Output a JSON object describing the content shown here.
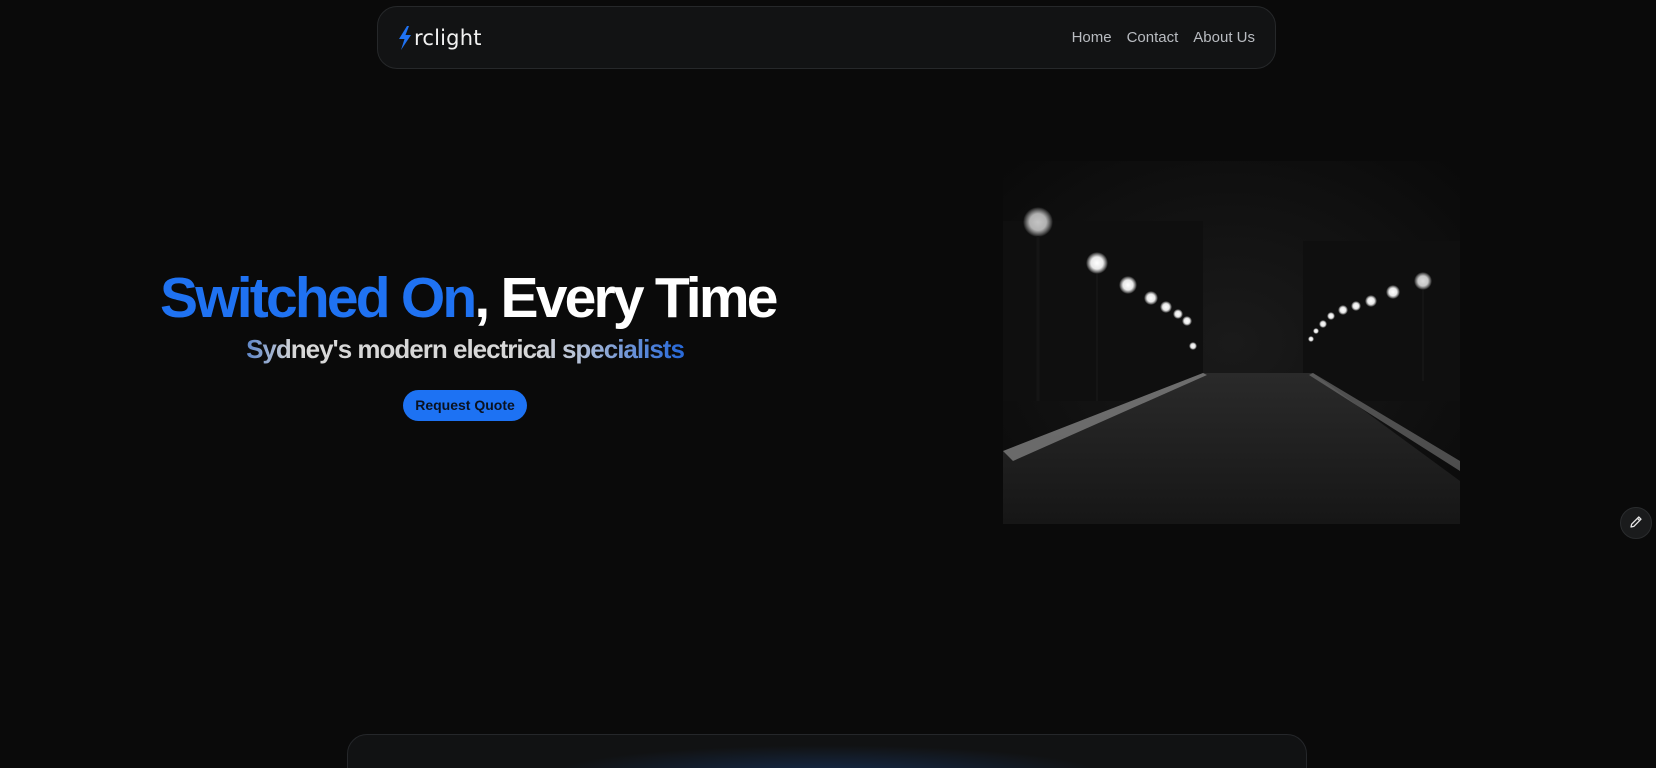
{
  "brand": {
    "logo_text": "rclight",
    "accent_color": "#1f72f2"
  },
  "nav": {
    "links": [
      "Home",
      "Contact",
      "About Us"
    ]
  },
  "hero": {
    "title_accent": "Switched On",
    "title_rest": ", Every Time",
    "subtitle": "Sydney's modern electrical specialists",
    "cta_label": "Request Quote"
  },
  "icons": {
    "logo": "lightning-bolt-icon",
    "edit": "pencil-icon"
  }
}
